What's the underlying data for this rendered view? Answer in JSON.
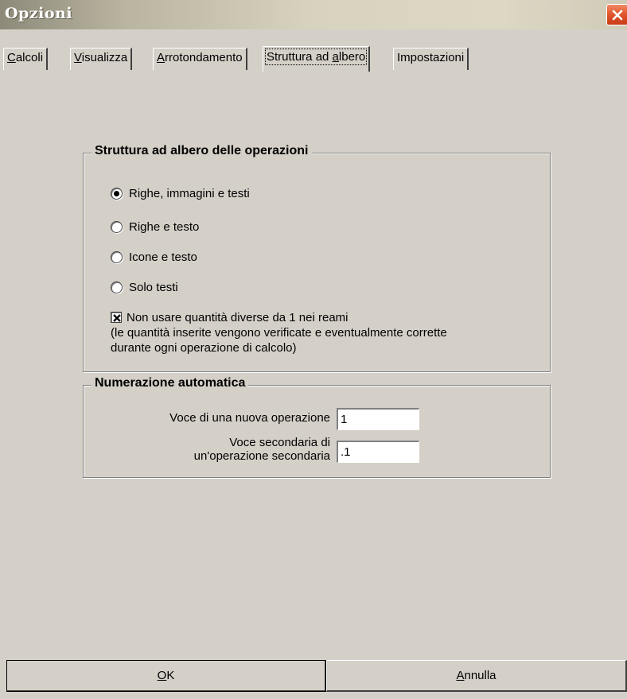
{
  "window": {
    "title": "Opzioni",
    "close_icon": "close-icon"
  },
  "tabs": [
    {
      "label_u": "C",
      "label_rest": "alcoli"
    },
    {
      "label_u": "V",
      "label_rest": "isualizza"
    },
    {
      "label_u": "A",
      "label_rest": "rrotondamento"
    },
    {
      "label_pre": "Struttura ad ",
      "label_u": "a",
      "label_rest": "lbero",
      "active": true
    },
    {
      "label_pre": "Impostazioni",
      "label_u": "",
      "label_rest": ""
    }
  ],
  "tree_group": {
    "title": "Struttura ad albero delle operazioni",
    "options": [
      {
        "label": "Righe, immagini e testi",
        "checked": true
      },
      {
        "label": "Righe e testo",
        "checked": false
      },
      {
        "label": "Icone e testo",
        "checked": false
      },
      {
        "label": "Solo testi",
        "checked": false
      }
    ],
    "checkbox": {
      "checked": true,
      "line1": "Non usare quantità diverse da 1 nei reami",
      "line2": "(le quantità inserite vengono verificate e eventualmente corrette",
      "line3": "durante ogni operazione di calcolo)"
    }
  },
  "numbering_group": {
    "title": "Numerazione automatica",
    "field1": {
      "label": "Voce di una nuova operazione",
      "value": "1"
    },
    "field2": {
      "label_line1": "Voce secondaria di",
      "label_line2": "un'operazione secondaria",
      "value": ".1"
    }
  },
  "buttons": {
    "ok_u": "O",
    "ok_rest": "K",
    "cancel_u": "A",
    "cancel_rest": "nnulla"
  }
}
